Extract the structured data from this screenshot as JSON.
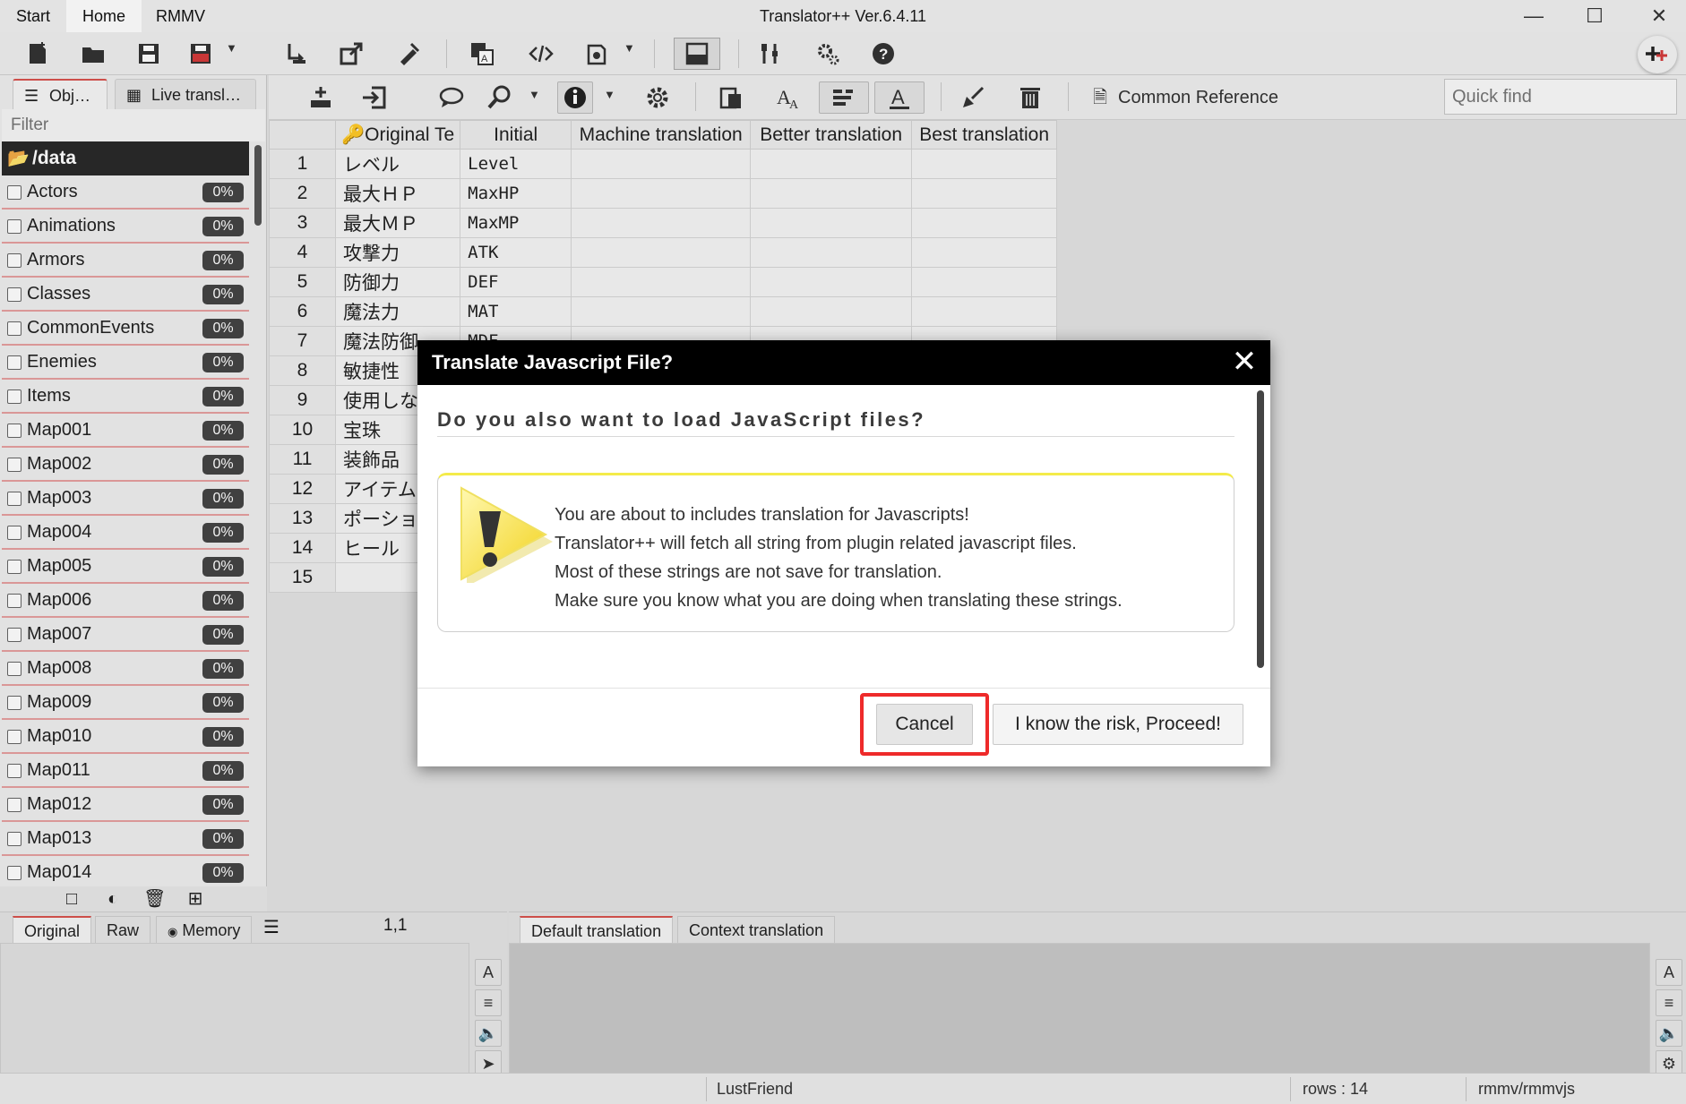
{
  "app": {
    "title": "Translator++ Ver.6.4.11",
    "menu_tabs": [
      "Start",
      "Home",
      "RMMV"
    ],
    "active_menu": "Home"
  },
  "toolbar": {
    "icons": [
      "new-project-icon",
      "open-folder-icon",
      "save-icon",
      "save-as-icon",
      "import-icon",
      "export-icon",
      "inject-icon",
      "translate-icon",
      "code-icon",
      "automation-icon",
      "layout-icon",
      "tools-icon",
      "settings-icon",
      "help-icon",
      "add-plugin-icon"
    ]
  },
  "left_panel": {
    "tabs": [
      "Obj…",
      "Live transl…"
    ],
    "filter_placeholder": "Filter",
    "folder": "/data",
    "files": [
      {
        "name": "Actors",
        "progress": "0%"
      },
      {
        "name": "Animations",
        "progress": "0%"
      },
      {
        "name": "Armors",
        "progress": "0%"
      },
      {
        "name": "Classes",
        "progress": "0%"
      },
      {
        "name": "CommonEvents",
        "progress": "0%"
      },
      {
        "name": "Enemies",
        "progress": "0%"
      },
      {
        "name": "Items",
        "progress": "0%"
      },
      {
        "name": "Map001",
        "progress": "0%"
      },
      {
        "name": "Map002",
        "progress": "0%"
      },
      {
        "name": "Map003",
        "progress": "0%"
      },
      {
        "name": "Map004",
        "progress": "0%"
      },
      {
        "name": "Map005",
        "progress": "0%"
      },
      {
        "name": "Map006",
        "progress": "0%"
      },
      {
        "name": "Map007",
        "progress": "0%"
      },
      {
        "name": "Map008",
        "progress": "0%"
      },
      {
        "name": "Map009",
        "progress": "0%"
      },
      {
        "name": "Map010",
        "progress": "0%"
      },
      {
        "name": "Map011",
        "progress": "0%"
      },
      {
        "name": "Map012",
        "progress": "0%"
      },
      {
        "name": "Map013",
        "progress": "0%"
      },
      {
        "name": "Map014",
        "progress": "0%"
      }
    ]
  },
  "toolbar2": {
    "common_reference": "Common Reference",
    "quick_find_placeholder": "Quick find"
  },
  "grid": {
    "headers": [
      "Original Te",
      "Initial",
      "Machine translation",
      "Better translation",
      "Best translation"
    ],
    "rows": [
      {
        "n": "1",
        "original": "レベル",
        "initial": "Level"
      },
      {
        "n": "2",
        "original": "最大ＨＰ",
        "initial": "MaxHP"
      },
      {
        "n": "3",
        "original": "最大ＭＰ",
        "initial": "MaxMP"
      },
      {
        "n": "4",
        "original": "攻撃力",
        "initial": "ATK"
      },
      {
        "n": "5",
        "original": "防御力",
        "initial": "DEF"
      },
      {
        "n": "6",
        "original": "魔法力",
        "initial": "MAT"
      },
      {
        "n": "7",
        "original": "魔法防御",
        "initial": "MDF"
      },
      {
        "n": "8",
        "original": "敏捷性",
        "initial": ""
      },
      {
        "n": "9",
        "original": "使用しな",
        "initial": ""
      },
      {
        "n": "10",
        "original": "宝珠",
        "initial": ""
      },
      {
        "n": "11",
        "original": "装飾品",
        "initial": ""
      },
      {
        "n": "12",
        "original": "アイテム",
        "initial": ""
      },
      {
        "n": "13",
        "original": "ポーショ",
        "initial": ""
      },
      {
        "n": "14",
        "original": "ヒール",
        "initial": ""
      },
      {
        "n": "15",
        "original": "",
        "initial": ""
      }
    ]
  },
  "bottom_left": {
    "tabs": [
      "Original",
      "Raw",
      "Memory"
    ],
    "cell_position": "1,1"
  },
  "bottom_right": {
    "tabs": [
      "Default translation",
      "Context translation"
    ]
  },
  "status": {
    "project": "LustFriend",
    "rows": "rows : 14",
    "engine": "rmmv/rmmvjs"
  },
  "dialog": {
    "title": "Translate Javascript File?",
    "heading": "Do you also want to load JavaScript files?",
    "lines": [
      "You are about to includes translation for Javascripts!",
      "Translator++ will fetch all string from plugin related javascript files.",
      "Most of these strings are not save for translation.",
      "Make sure you know what you are doing when translating these strings."
    ],
    "cancel_label": "Cancel",
    "proceed_label": "I know the risk, Proceed!"
  },
  "colors": {
    "dialog_titlebar": "#000000",
    "highlight": "#ee2a2a",
    "warning_yellow": "#f4eb4a",
    "progress_badge": "#444444"
  }
}
